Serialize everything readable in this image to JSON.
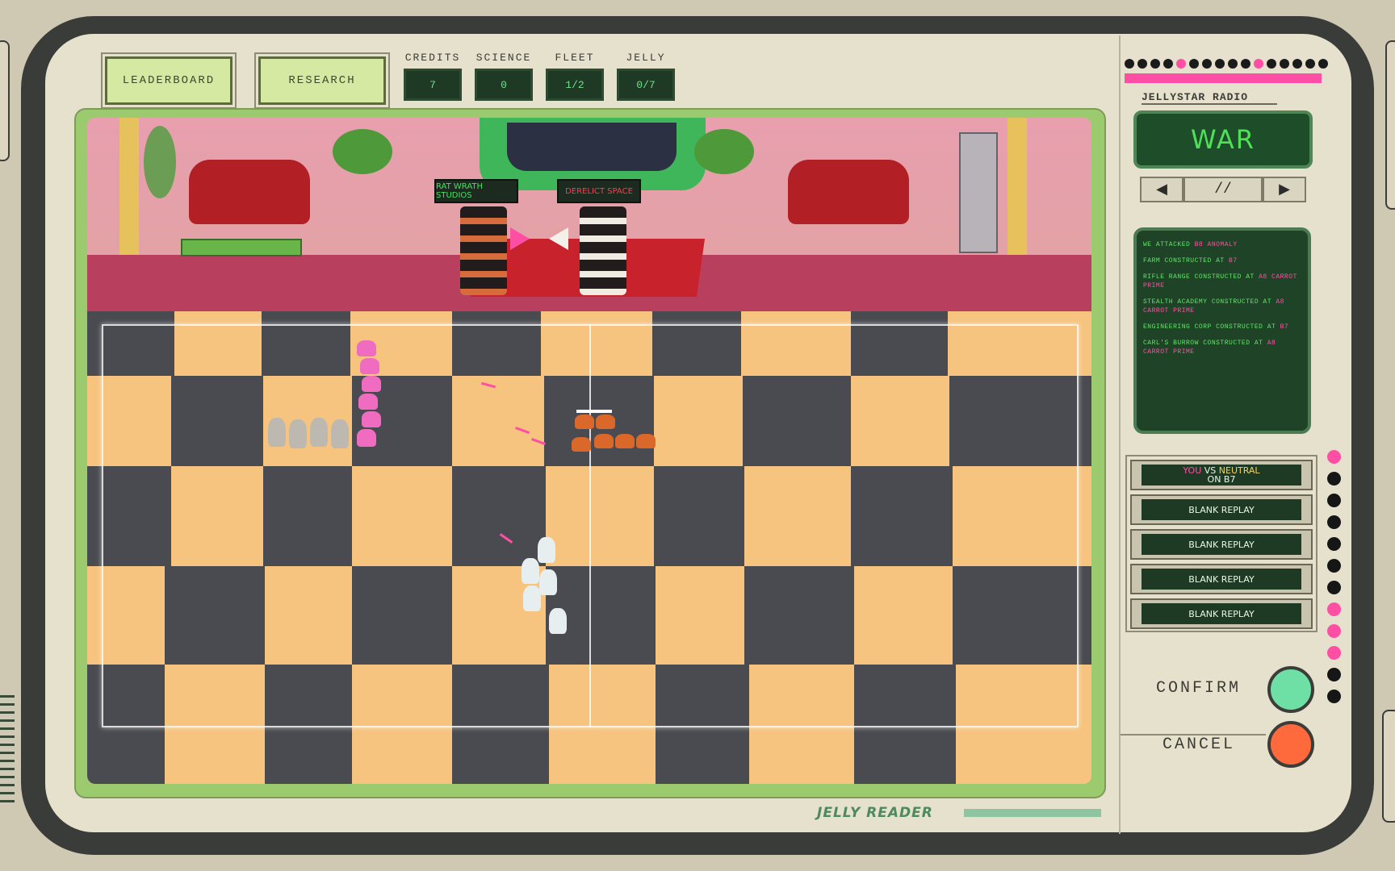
{
  "toolbar": {
    "leaderboard_label": "LEADERBOARD",
    "research_label": "RESEARCH"
  },
  "stats": [
    {
      "label": "CREDITS",
      "value": "7"
    },
    {
      "label": "SCIENCE",
      "value": "0"
    },
    {
      "label": "FLEET",
      "value": "1/2"
    },
    {
      "label": "JELLY",
      "value": "0/7"
    }
  ],
  "scene": {
    "left_sign": "RAT WRATH STUDIOS",
    "right_sign": "DERELICT SPACE"
  },
  "radio": {
    "label": "JELLYSTAR RADIO",
    "station": "WAR",
    "prev": "◀",
    "pause": "//",
    "next": "▶"
  },
  "log": [
    {
      "text": "WE ATTACKED ",
      "hl": "B8 ANOMALY"
    },
    {
      "text": "FARM CONSTRUCTED AT ",
      "hl": "B7"
    },
    {
      "text": "RIFLE RANGE CONSTRUCTED AT ",
      "hl": "A8 CARROT PRIME"
    },
    {
      "text": "STEALTH ACADEMY CONSTRUCTED AT ",
      "hl": "A8 CARROT PRIME"
    },
    {
      "text": "ENGINEERING CORP CONSTRUCTED AT ",
      "hl": "B7"
    },
    {
      "text": "CARL'S BURROW CONSTRUCTED AT ",
      "hl": "A8 CARROT PRIME"
    }
  ],
  "replays": {
    "current": {
      "you": "YOU",
      "vs": " VS ",
      "enemy": "NEUTRAL",
      "where": "ON B7"
    },
    "blank": [
      "BLANK REPLAY",
      "BLANK REPLAY",
      "BLANK REPLAY",
      "BLANK REPLAY"
    ]
  },
  "actions": {
    "confirm_label": "CONFIRM",
    "cancel_label": "CANCEL"
  },
  "brand": "JELLY READER",
  "colors": {
    "accent_pink": "#ff4fa4",
    "terminal_green": "#4ee056",
    "confirm": "#6fe0a5",
    "cancel": "#ff6a3d"
  }
}
